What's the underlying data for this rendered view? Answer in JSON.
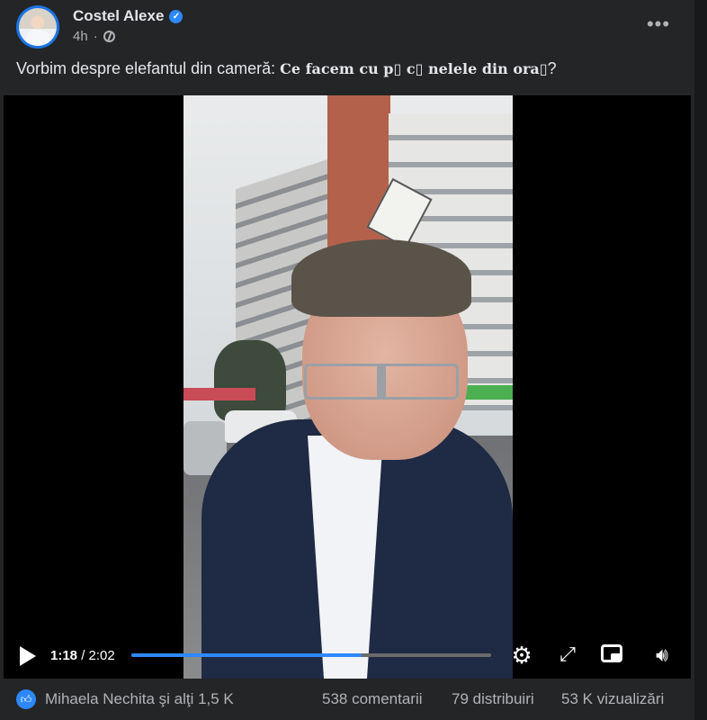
{
  "post": {
    "author": "Costel Alexe",
    "time": "4h",
    "more_label": "•••",
    "caption_prefix": "Vorbim despre elefantul din cameră: ",
    "caption_bold": "Ce facem cu p▯ c▯ nelele din ora▯",
    "caption_suffix": "?"
  },
  "video": {
    "current_time": "1:18",
    "separator": " / ",
    "duration": "2:02",
    "progress": 0.639,
    "settings_icon": "gear-icon",
    "fullscreen_icon": "fullscreen-icon",
    "pip_icon": "picture-in-picture-icon",
    "volume_icon": "volume-icon"
  },
  "footer": {
    "reactions": "Mihaela Nechita şi alţi 1,5 K",
    "comments": "538 comentarii",
    "shares": "79 distribuiri",
    "views": "53 K vizualizări"
  },
  "colors": {
    "background": "#242526",
    "accent": "#2d88ff",
    "text_primary": "#e4e6eb",
    "text_secondary": "#b0b3b8"
  }
}
